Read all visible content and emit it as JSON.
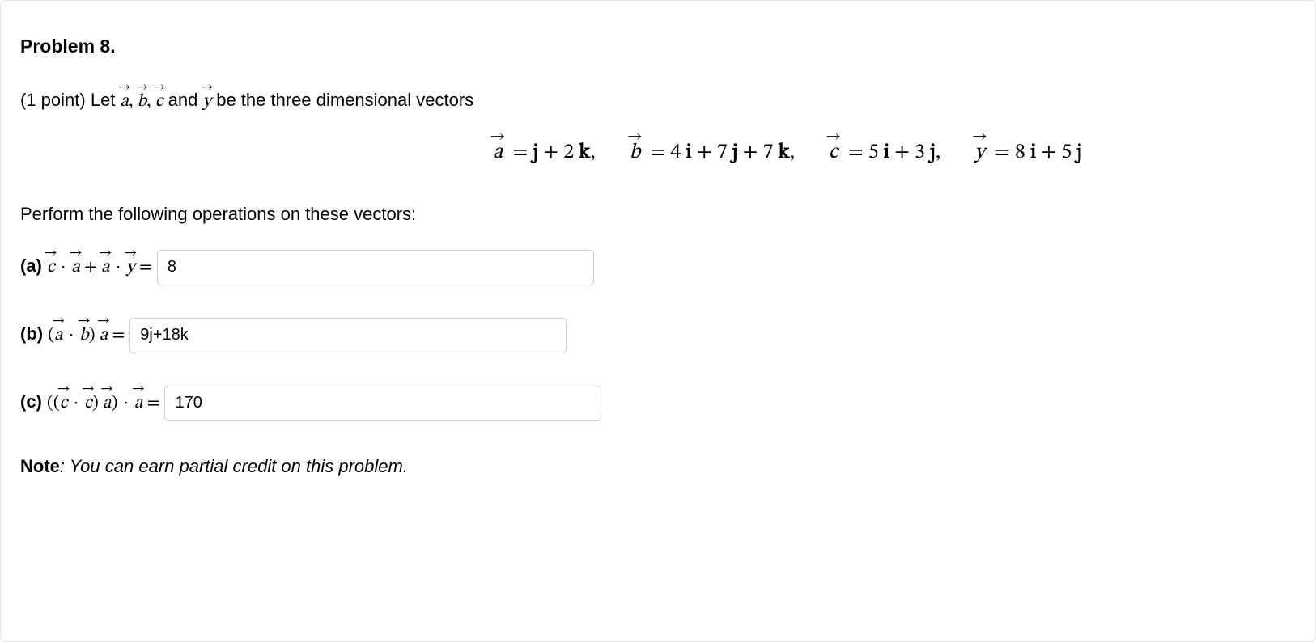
{
  "title": "Problem 8.",
  "points_prefix": "(1 point) ",
  "intro_1": "Let ",
  "intro_2": " and ",
  "intro_3": " be the three dimensional vectors",
  "vectors": {
    "a": "a",
    "b": "b",
    "c": "c",
    "y": "y"
  },
  "eq": {
    "a_def_lhs": "a",
    "a_def_rhs": " = j + 2 k,",
    "b_def_lhs": "b",
    "b_def_rhs": " = 4 i + 7 j + 7 k,",
    "c_def_lhs": "c",
    "c_def_rhs": " = 5 i + 3 j,",
    "y_def_lhs": "y",
    "y_def_rhs": " = 8 i + 5 j"
  },
  "op_instruction": "Perform the following operations on these vectors:",
  "parts": {
    "a": {
      "label": "(a) ",
      "eq_tail": " = ",
      "value": "8"
    },
    "b": {
      "label": "(b) ",
      "eq_tail": " = ",
      "value": "9j+18k"
    },
    "c": {
      "label": "(c) ",
      "eq_tail": " = ",
      "value": "170"
    }
  },
  "note_label": "Note",
  "note_text": ": You can earn partial credit on this problem."
}
